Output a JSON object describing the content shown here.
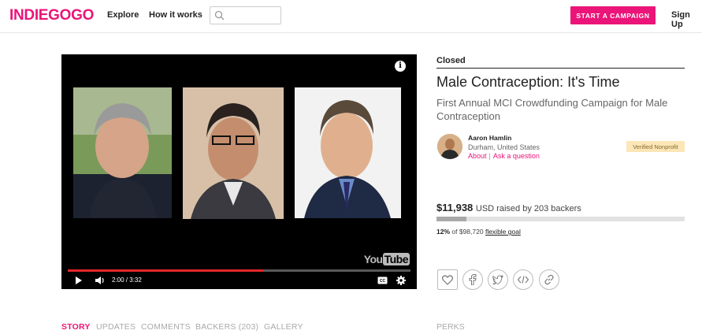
{
  "header": {
    "logo": "INDIEGOGO",
    "nav": [
      "Explore",
      "How it works"
    ],
    "search_placeholder": "",
    "start_campaign": "START A CAMPAIGN",
    "sign_up": "Sign Up"
  },
  "video": {
    "current_time": "2:00",
    "duration": "3:32",
    "time_display": "2:00 / 3:32",
    "progress_fraction": 0.57,
    "watermark": "You",
    "watermark_tube": "Tube",
    "info_glyph": "i"
  },
  "campaign": {
    "status": "Closed",
    "title": "Male Contraception: It's Time",
    "subtitle": "First Annual MCI Crowdfunding Campaign for Male Contraception",
    "owner": {
      "name": "Aaron Hamlin",
      "location": "Durham, United States",
      "about": "About",
      "ask": "Ask a question",
      "separator": "|",
      "badge": "Verified Nonprofit"
    },
    "funding": {
      "amount": "$11,938",
      "amount_rest": "USD raised by 203 backers",
      "percent": "12%",
      "goal_text": "of $98,720",
      "goal_type": "flexible goal",
      "progress_fraction": 0.12
    }
  },
  "share_icons": [
    "heart-icon",
    "facebook-icon",
    "twitter-icon",
    "embed-icon",
    "link-icon"
  ],
  "tabs": [
    "STORY",
    "UPDATES",
    "COMMENTS",
    "BACKERS (203)",
    "GALLERY"
  ],
  "perks_label": "PERKS",
  "colors": {
    "brand": "#eb1478",
    "verified_bg": "#fbe6b8",
    "video_progress": "#e4262a"
  }
}
